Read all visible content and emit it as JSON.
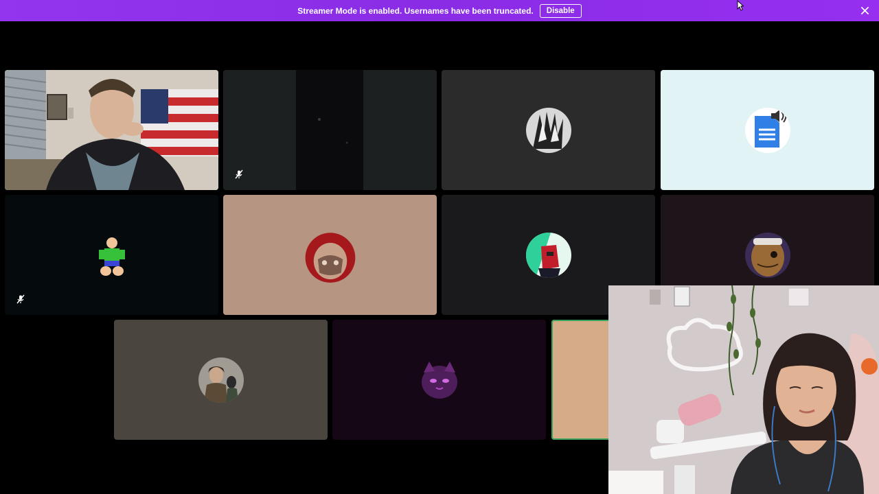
{
  "banner": {
    "message": "Streamer Mode is enabled. Usernames have been truncated.",
    "button_label": "Disable",
    "background": "#9335ee"
  },
  "icons": {
    "close": "close-icon",
    "mute": "muted-microphone-icon",
    "cursor": "mouse-pointer-icon"
  },
  "grid": {
    "tiles": [
      {
        "id": "tile-1",
        "kind": "camera-video",
        "background": "#cfc6ba"
      },
      {
        "id": "tile-2",
        "kind": "dark-video",
        "background": "#1b1f20",
        "muted": true
      },
      {
        "id": "tile-3",
        "kind": "avatar",
        "background": "#2b2b2b",
        "avatar": "black-and-white-hands-avatar"
      },
      {
        "id": "tile-4",
        "kind": "avatar",
        "background": "#e2f3f6",
        "avatar": "document-speaker-avatar"
      },
      {
        "id": "tile-5",
        "kind": "avatar",
        "background": "#050a0c",
        "avatar": "green-figure-avatar",
        "muted": true
      },
      {
        "id": "tile-6",
        "kind": "avatar",
        "background": "#b79583",
        "avatar": "red-hood-avatar"
      },
      {
        "id": "tile-7",
        "kind": "avatar",
        "background": "#1a1a1c",
        "avatar": "robot-character-avatar"
      },
      {
        "id": "tile-8",
        "kind": "avatar",
        "background": "#1d151a",
        "avatar": "sack-mask-avatar"
      },
      {
        "id": "tile-9",
        "kind": "avatar",
        "background": "#4a453e",
        "avatar": "soldier-character-avatar"
      },
      {
        "id": "tile-10",
        "kind": "avatar",
        "background": "#150716",
        "avatar": "purple-cat-avatar"
      },
      {
        "id": "tile-11",
        "kind": "speaking",
        "background": "#d5ab88",
        "accent": "#3ba55c"
      }
    ]
  },
  "pip": {
    "kind": "streamer-camera"
  }
}
